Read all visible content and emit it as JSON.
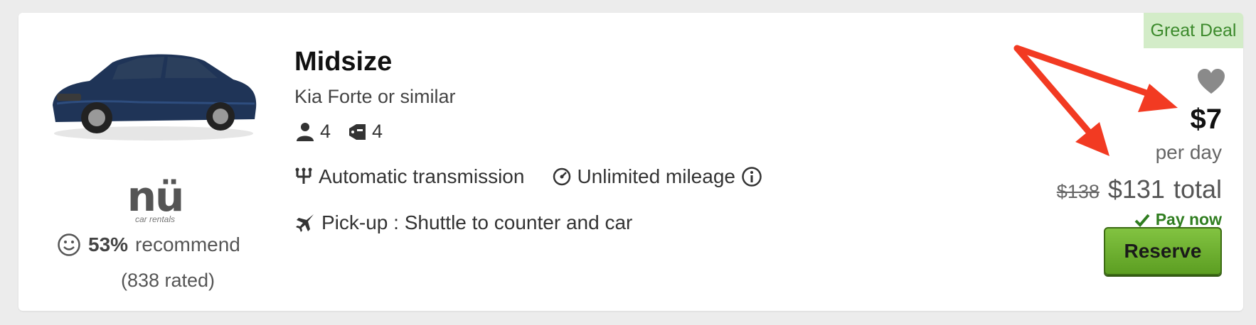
{
  "listing": {
    "category": "Midsize",
    "model": "Kia Forte or similar",
    "passengers": "4",
    "bags": "4",
    "transmission": "Automatic transmission",
    "mileage": "Unlimited mileage",
    "pickup": "Pick-up : Shuttle to counter and car"
  },
  "vendor": {
    "logo_text": "nü",
    "logo_subtext": "car rentals",
    "recommend_pct": "53%",
    "recommend_label": "recommend",
    "rated": "(838 rated)"
  },
  "pricing": {
    "badge": "Great Deal",
    "daily_price": "$7",
    "per_day_label": "per day",
    "original_total": "$138",
    "total": "$131",
    "total_label": "total",
    "pay_now": "Pay now",
    "reserve_label": "Reserve"
  },
  "icons": {
    "passenger": "person-icon",
    "bags": "bag-icon",
    "transmission": "gear-shift-icon",
    "mileage": "speedometer-icon",
    "info": "info-icon",
    "pickup": "plane-icon",
    "favorite": "heart-icon",
    "pay_now": "check-icon",
    "recommend": "smiley-icon"
  },
  "colors": {
    "badge_bg": "#d3ecc8",
    "badge_text": "#3c8a2c",
    "button_green": "#6cb33f",
    "annotation_arrow": "#f23a22"
  }
}
